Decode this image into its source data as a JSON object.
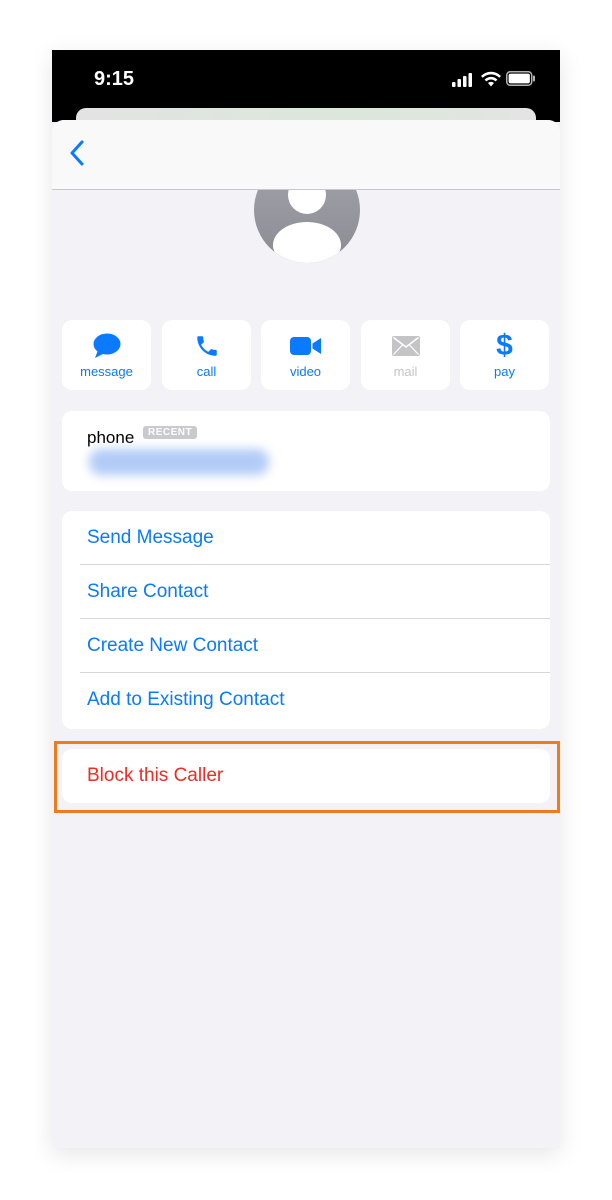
{
  "status_bar": {
    "time": "9:15"
  },
  "nav": {
    "back_icon": "chevron-left-icon"
  },
  "avatar_icon": "person-silhouette-icon",
  "actions": [
    {
      "label": "message",
      "icon": "message-bubble-icon",
      "enabled": true
    },
    {
      "label": "call",
      "icon": "phone-icon",
      "enabled": true
    },
    {
      "label": "video",
      "icon": "video-camera-icon",
      "enabled": true
    },
    {
      "label": "mail",
      "icon": "envelope-icon",
      "enabled": false
    },
    {
      "label": "pay",
      "icon": "dollar-icon",
      "enabled": true
    }
  ],
  "phone_card": {
    "label": "phone",
    "badge": "RECENT"
  },
  "options": [
    {
      "label": "Send Message"
    },
    {
      "label": "Share Contact"
    },
    {
      "label": "Create New Contact"
    },
    {
      "label": "Add to Existing Contact"
    }
  ],
  "block": {
    "label": "Block this Caller"
  },
  "colors": {
    "accent": "#0a7aff",
    "destructive": "#ee2b24",
    "highlight": "#f07b1e",
    "background": "#f2f2f7"
  }
}
